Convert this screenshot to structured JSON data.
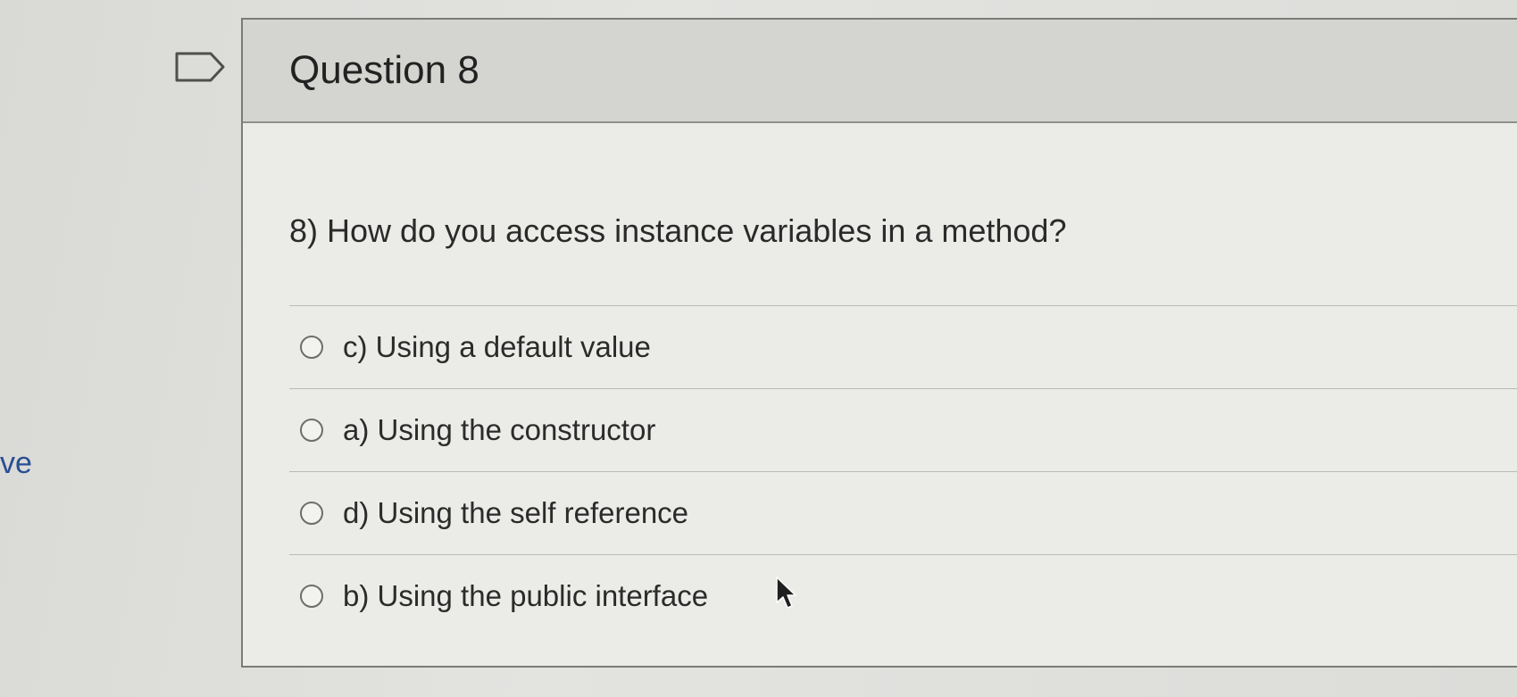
{
  "side_fragment": "ve",
  "question": {
    "title": "Question 8",
    "text": "8) How do you access instance variables in a method?",
    "answers": [
      {
        "label": "c) Using a default value"
      },
      {
        "label": "a) Using the constructor"
      },
      {
        "label": "d) Using the self reference"
      },
      {
        "label": "b) Using the public interface"
      }
    ]
  },
  "icons": {
    "flag": "flag-outline-icon",
    "cursor": "mouse-pointer-icon"
  },
  "colors": {
    "side_text": "#2a4e93",
    "header_bg": "#d4d4d1",
    "body_bg": "#ebebe8"
  }
}
